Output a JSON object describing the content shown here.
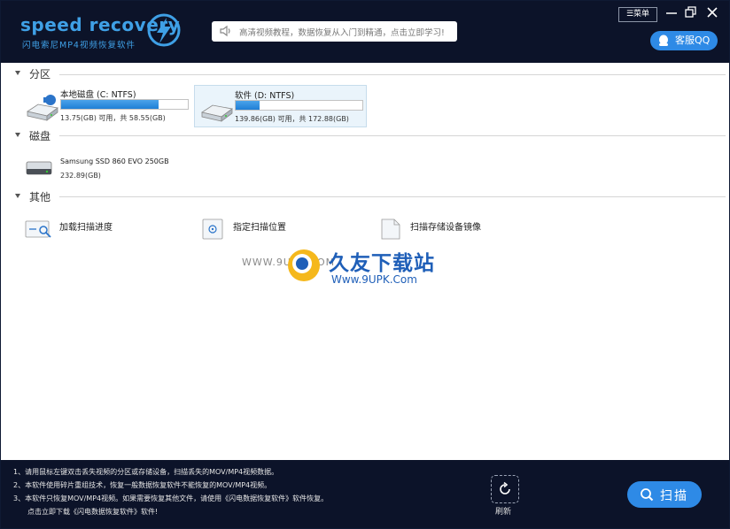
{
  "app": {
    "logo_text": "speed recovery",
    "logo_subtitle": "闪电索尼MP4视频恢复软件",
    "notice": "高清视频教程，数据恢复从入门到精通，点击立即学习!",
    "menu_label": "菜单",
    "qq_label": "客服QQ"
  },
  "sections": {
    "partition": "分区",
    "disk": "磁盘",
    "other": "其他"
  },
  "partitions": [
    {
      "name": "本地磁盘 (C: NTFS)",
      "size": "13.75(GB) 可用，共 58.55(GB)",
      "used_fraction": 0.77,
      "selected": false
    },
    {
      "name": "软件 (D: NTFS)",
      "size": "139.86(GB) 可用，共 172.88(GB)",
      "used_fraction": 0.19,
      "selected": true
    }
  ],
  "disks": [
    {
      "name": "Samsung SSD 860 EVO 250GB",
      "size": "232.89(GB)"
    }
  ],
  "others": [
    {
      "label": "加载扫描进度",
      "icon": "load-scan-icon"
    },
    {
      "label": "指定扫描位置",
      "icon": "target-location-icon"
    },
    {
      "label": "扫描存储设备镜像",
      "icon": "image-file-icon"
    }
  ],
  "watermark": {
    "url1": "WWW.9UPK.COM",
    "title": "久友下载站",
    "url2": "Www.9UPK.Com"
  },
  "footer": {
    "tips": [
      "1、请用鼠标左键双击丢失视频的分区或存储设备，扫描丢失的MOV/MP4视频数据。",
      "2、本软件使用碎片重组技术，恢复一般数据恢复软件不能恢复的MOV/MP4视频。",
      "3、本软件只恢复MOV/MP4视频。如果需要恢复其他文件，请使用《闪电数据恢复软件》软件恢复。",
      "点击立即下载《闪电数据恢复软件》软件!"
    ],
    "refresh_label": "刷新",
    "scan_label": "扫描"
  },
  "colors": {
    "header_bg": "#0c1329",
    "accent": "#2e8ae6",
    "bar_fill": "#1f7fd6"
  }
}
